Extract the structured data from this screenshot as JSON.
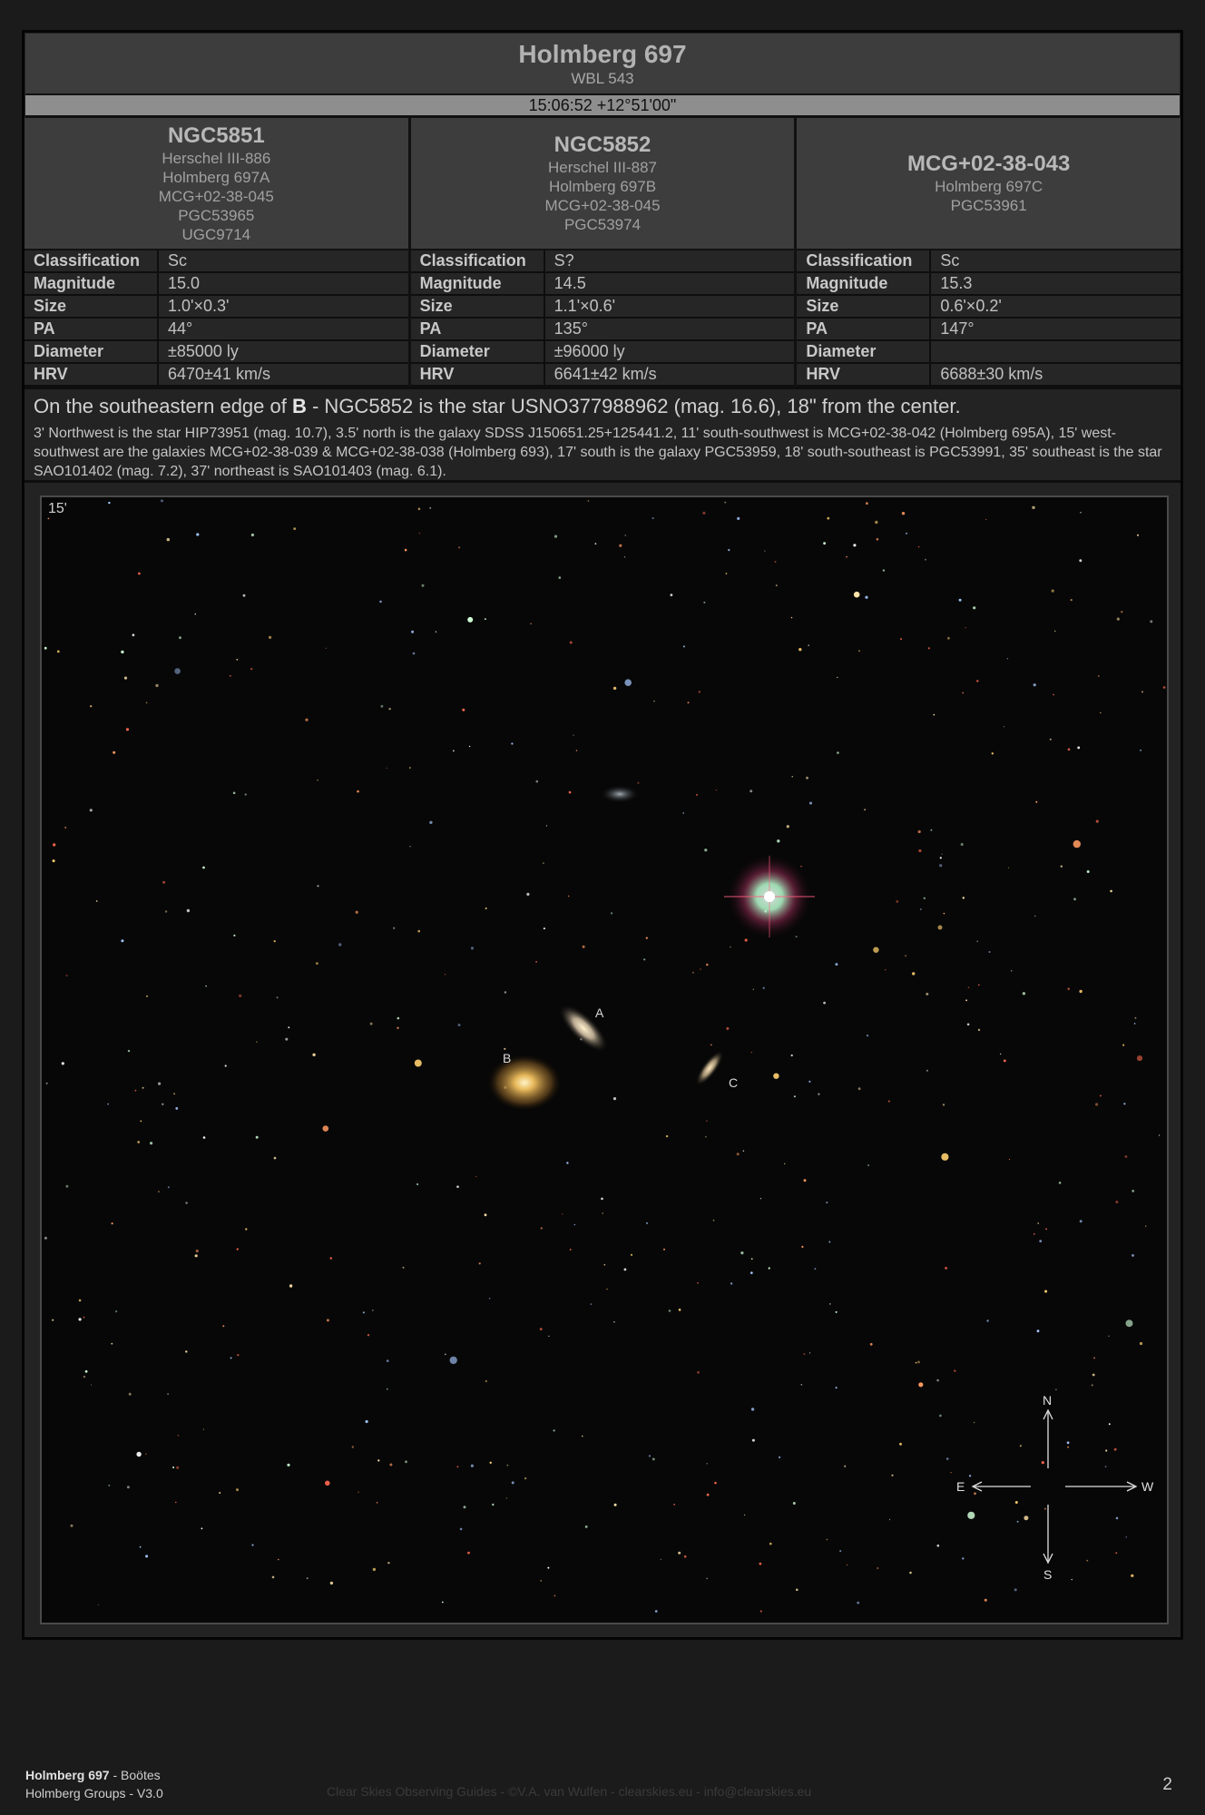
{
  "header": {
    "title": "Holmberg 697",
    "subtitle": "WBL 543",
    "coordinates": "15:06:52 +12°51'00\""
  },
  "galaxies": [
    {
      "name": "NGC5851",
      "aliases": [
        "Herschel III-886",
        "Holmberg 697A",
        "MCG+02-38-045",
        "PGC53965",
        "UGC9714"
      ],
      "classification": "Sc",
      "magnitude": "15.0",
      "size": "1.0'×0.3'",
      "pa": "44°",
      "diameter": "±85000 ly",
      "hrv": "6470±41 km/s"
    },
    {
      "name": "NGC5852",
      "aliases": [
        "Herschel III-887",
        "Holmberg 697B",
        "MCG+02-38-045",
        "PGC53974"
      ],
      "classification": "S?",
      "magnitude": "14.5",
      "size": "1.1'×0.6'",
      "pa": "135°",
      "diameter": "±96000 ly",
      "hrv": "6641±42 km/s"
    },
    {
      "name": "MCG+02-38-043",
      "aliases": [
        "Holmberg 697C",
        "PGC53961"
      ],
      "classification": "Sc",
      "magnitude": "15.3",
      "size": "0.6'×0.2'",
      "pa": "147°",
      "diameter": "",
      "hrv": "6688±30 km/s"
    }
  ],
  "row_labels": {
    "classification": "Classification",
    "magnitude": "Magnitude",
    "size": "Size",
    "pa": "PA",
    "diameter": "Diameter",
    "hrv": "HRV"
  },
  "notes": {
    "lead_prefix": "On the southeastern edge of ",
    "lead_bold": "B",
    "lead_suffix": " - NGC5852 is the star USNO377988962 (mag. 16.6), 18\" from the center.",
    "detail": "3' Northwest is the star HIP73951 (mag. 10.7), 3.5' north is the galaxy SDSS J150651.25+125441.2, 11' south-southwest is MCG+02-38-042 (Holmberg 695A), 15' west-southwest are the galaxies MCG+02-38-039 & MCG+02-38-038 (Holmberg 693), 17' south is the galaxy PGC53959, 18' south-southeast is PGC53991, 35' southeast is the star SAO101402 (mag. 7.2), 37' northeast is SAO101403 (mag. 6.1)."
  },
  "image": {
    "scale_label": "15'",
    "galaxy_labels": [
      "A",
      "B",
      "C"
    ],
    "compass": {
      "north": "N",
      "south": "S",
      "east": "E",
      "west": "W"
    }
  },
  "footer": {
    "group_name": "Holmberg 697",
    "constellation": " - Boötes",
    "series": "Holmberg Groups - V3.0",
    "credits": "Clear Skies Observing Guides - ©V.A. van Wulfen - clearskies.eu - info@clearskies.eu",
    "page_number": "2"
  }
}
